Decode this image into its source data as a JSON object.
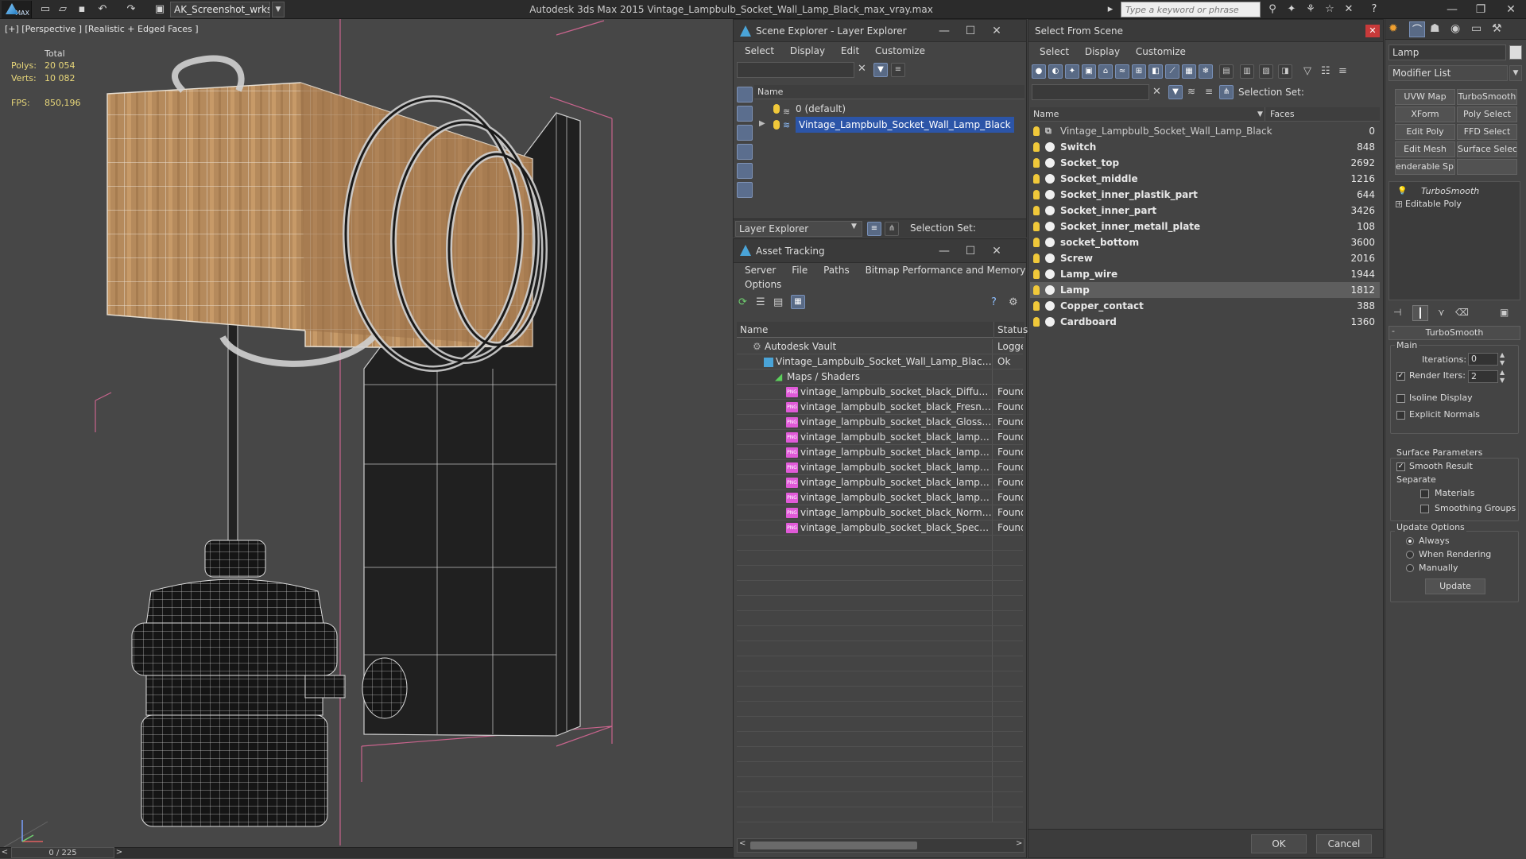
{
  "app": {
    "title": "Autodesk 3ds Max  2015    Vintage_Lampbulb_Socket_Wall_Lamp_Black_max_vray.max",
    "logo_text": "MAX",
    "workspace": "AK_Screenshot_wrksp",
    "search_placeholder": "Type a keyword or phrase",
    "colors": {
      "background": "#444444",
      "selection": "#2c55a8",
      "stats": "#e8d77a",
      "bulb": "#f0c83a",
      "png_icon": "#e05ad8"
    }
  },
  "viewport": {
    "label": "[+] [Perspective ] [Realistic + Edged Faces ]",
    "stats": {
      "total_label": "Total",
      "polys_label": "Polys:",
      "polys": "20 054",
      "verts_label": "Verts:",
      "verts": "10 082",
      "fps_label": "FPS:",
      "fps": "850,196"
    },
    "timeslider": "0 / 225"
  },
  "scene_explorer": {
    "title": "Scene Explorer - Layer Explorer",
    "menu": [
      "Select",
      "Display",
      "Edit",
      "Customize"
    ],
    "column": "Name",
    "rows": [
      {
        "label": "0 (default)",
        "selected": false
      },
      {
        "label": "Vintage_Lampbulb_Socket_Wall_Lamp_Black",
        "selected": true
      }
    ],
    "footer_dropdown": "Layer Explorer",
    "selection_set_label": "Selection Set:"
  },
  "asset_tracking": {
    "title": "Asset Tracking",
    "menu": [
      "Server",
      "File",
      "Paths",
      "Bitmap Performance and Memory"
    ],
    "menu2": [
      "Options"
    ],
    "columns": [
      "Name",
      "Status"
    ],
    "rows": [
      {
        "name": "Autodesk Vault",
        "status": "Logged",
        "level": 0,
        "icon": "vault-icon"
      },
      {
        "name": "Vintage_Lampbulb_Socket_Wall_Lamp_Black_m...",
        "status": "Ok",
        "level": 1,
        "icon": "max-file-icon"
      },
      {
        "name": "Maps / Shaders",
        "status": "",
        "level": 2,
        "icon": "maps-icon"
      },
      {
        "name": "vintage_lampbulb_socket_black_Diffuse.p...",
        "status": "Found",
        "level": 3,
        "icon": "png-icon"
      },
      {
        "name": "vintage_lampbulb_socket_black_Fresnel.p...",
        "status": "Found",
        "level": 3,
        "icon": "png-icon"
      },
      {
        "name": "vintage_lampbulb_socket_black_Glossines...",
        "status": "Found",
        "level": 3,
        "icon": "png-icon"
      },
      {
        "name": "vintage_lampbulb_socket_black_lamp_Dif...",
        "status": "Found",
        "level": 3,
        "icon": "png-icon"
      },
      {
        "name": "vintage_lampbulb_socket_black_lamp_Fre...",
        "status": "Found",
        "level": 3,
        "icon": "png-icon"
      },
      {
        "name": "vintage_lampbulb_socket_black_lamp_Gl...",
        "status": "Found",
        "level": 3,
        "icon": "png-icon"
      },
      {
        "name": "vintage_lampbulb_socket_black_lamp_No...",
        "status": "Found",
        "level": 3,
        "icon": "png-icon"
      },
      {
        "name": "vintage_lampbulb_socket_black_lamp_Sp...",
        "status": "Found",
        "level": 3,
        "icon": "png-icon"
      },
      {
        "name": "vintage_lampbulb_socket_black_Normal....",
        "status": "Found",
        "level": 3,
        "icon": "png-icon"
      },
      {
        "name": "vintage_lampbulb_socket_black_Specular....",
        "status": "Found",
        "level": 3,
        "icon": "png-icon"
      }
    ]
  },
  "select_from_scene": {
    "title": "Select From Scene",
    "menu": [
      "Select",
      "Display",
      "Customize"
    ],
    "selection_set_label": "Selection Set:",
    "columns": [
      "Name",
      "Faces"
    ],
    "rows": [
      {
        "name": "Vintage_Lampbulb_Socket_Wall_Lamp_Black",
        "faces": "0",
        "root": true
      },
      {
        "name": "Switch",
        "faces": "848"
      },
      {
        "name": "Socket_top",
        "faces": "2692"
      },
      {
        "name": "Socket_middle",
        "faces": "1216"
      },
      {
        "name": "Socket_inner_plastik_part",
        "faces": "644"
      },
      {
        "name": "Socket_inner_part",
        "faces": "3426"
      },
      {
        "name": "Socket_inner_metall_plate",
        "faces": "108"
      },
      {
        "name": "socket_bottom",
        "faces": "3600"
      },
      {
        "name": "Screw",
        "faces": "2016"
      },
      {
        "name": "Lamp_wire",
        "faces": "1944"
      },
      {
        "name": "Lamp",
        "faces": "1812",
        "active": true
      },
      {
        "name": "Copper_contact",
        "faces": "388"
      },
      {
        "name": "Cardboard",
        "faces": "1360"
      }
    ],
    "ok": "OK",
    "cancel": "Cancel"
  },
  "command_panel": {
    "object_name": "Lamp",
    "modifier_list": "Modifier List",
    "modifier_buttons": [
      "UVW Map",
      "TurboSmooth",
      "XForm",
      "Poly Select",
      "Edit Poly",
      "FFD Select",
      "Edit Mesh",
      "Surface Select",
      "enderable Splin",
      ""
    ],
    "stack": [
      "TurboSmooth",
      "Editable Poly"
    ],
    "rollout_title": "TurboSmooth",
    "main_label": "Main",
    "iterations_label": "Iterations:",
    "iterations": "0",
    "render_iters_label": "Render Iters:",
    "render_iters": "2",
    "isoline_label": "Isoline Display",
    "explicit_label": "Explicit Normals",
    "surface_label": "Surface Parameters",
    "smooth_label": "Smooth Result",
    "separate_label": "Separate",
    "materials_label": "Materials",
    "smoothing_label": "Smoothing Groups",
    "update_options_label": "Update Options",
    "always": "Always",
    "when_rendering": "When Rendering",
    "manually": "Manually",
    "update_btn": "Update"
  }
}
